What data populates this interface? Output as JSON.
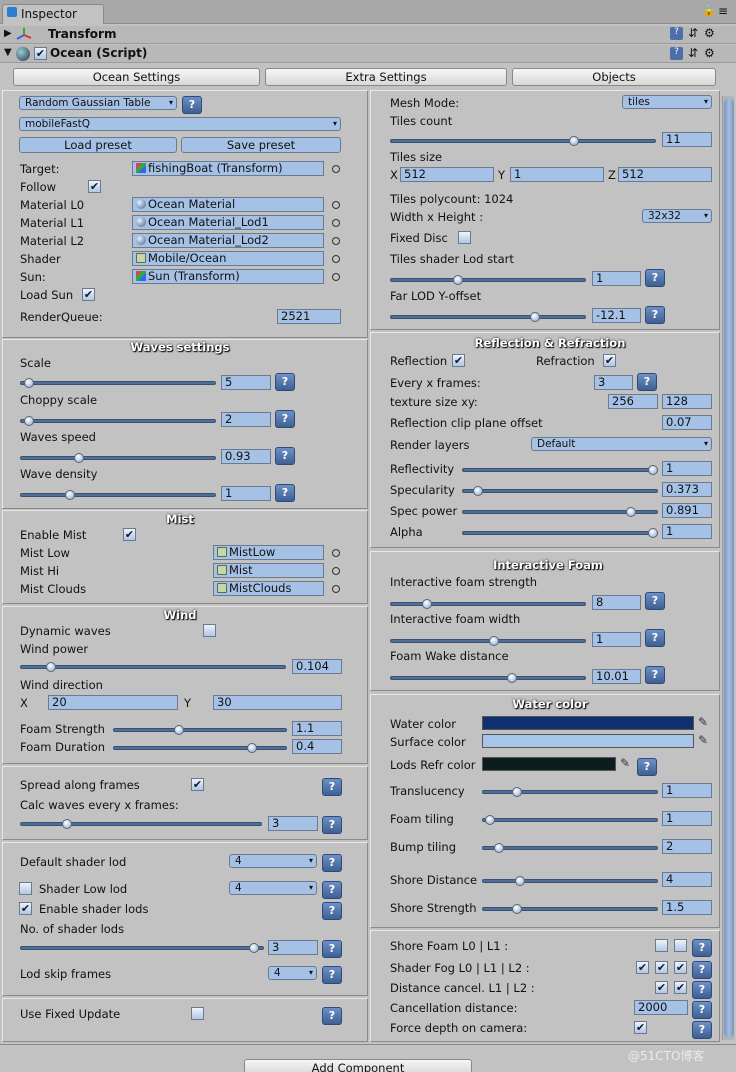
{
  "window": {
    "tab": "Inspector"
  },
  "transform": {
    "title": "Transform"
  },
  "ocean": {
    "title": "Ocean (Script)"
  },
  "tabs": {
    "ocean": "Ocean Settings",
    "extra": "Extra Settings",
    "objects": "Objects"
  },
  "left": {
    "table_dd": "Random Gaussian Table",
    "preset_dd": "mobileFastQ",
    "load_preset": "Load preset",
    "save_preset": "Save preset",
    "target_label": "Target:",
    "target_value": "fishingBoat (Transform)",
    "follow_label": "Follow",
    "mat0_label": "Material L0",
    "mat0_value": "Ocean Material",
    "mat1_label": "Material L1",
    "mat1_value": "Ocean Material_Lod1",
    "mat2_label": "Material L2",
    "mat2_value": "Ocean Material_Lod2",
    "shader_label": "Shader",
    "shader_value": "Mobile/Ocean",
    "sun_label": "Sun:",
    "sun_value": "Sun (Transform)",
    "loadsun_label": "Load Sun",
    "rq_label": "RenderQueue:",
    "rq_value": "2521",
    "waves_title": "Waves settings",
    "scale_label": "Scale",
    "scale_value": "5",
    "scale_frac": 0.02,
    "choppy_label": "Choppy scale",
    "choppy_value": "2",
    "choppy_frac": 0.02,
    "speed_label": "Waves speed",
    "speed_value": "0.93",
    "speed_frac": 0.29,
    "density_label": "Wave density",
    "density_value": "1",
    "density_frac": 0.24,
    "mist_title": "Mist",
    "enable_mist": "Enable Mist",
    "mistlow_label": "Mist Low",
    "mistlow_value": "MistLow",
    "misthi_label": "Mist Hi",
    "misthi_value": "Mist",
    "mistclouds_label": "Mist Clouds",
    "mistclouds_value": "MistClouds",
    "wind_title": "Wind",
    "dynamic_label": "Dynamic waves",
    "windpower_label": "Wind power",
    "windpower_value": "0.104",
    "windpower_frac": 0.1,
    "winddir_label": "Wind direction",
    "winddir_x_label": "X",
    "winddir_x": "20",
    "winddir_y_label": "Y",
    "winddir_y": "30",
    "foamstr_label": "Foam Strength",
    "foamstr_value": "1.1",
    "foamstr_frac": 0.37,
    "foamdur_label": "Foam Duration",
    "foamdur_value": "0.4",
    "foamdur_frac": 0.82,
    "spread_label": "Spread along frames",
    "calc_label": "Calc waves every x frames:",
    "calc_value": "3",
    "calc_frac": 0.18,
    "defshader_label": "Default shader lod",
    "defshader_value": "4",
    "shaderlow_label": "Shader Low lod",
    "shaderlow_value": "4",
    "enablelods_label": "Enable shader lods",
    "numlods_label": "No. of shader lods",
    "numlods_value": "3",
    "numlods_frac": 0.98,
    "lodskip_label": "Lod skip frames",
    "lodskip_value": "4",
    "fixedupd_label": "Use Fixed Update"
  },
  "right": {
    "meshmode_label": "Mesh Mode:",
    "meshmode_value": "tiles",
    "tilescount_label": "Tiles count",
    "tilescount_value": "11",
    "tilescount_frac": 0.7,
    "tilessize_label": "Tiles size",
    "ts_x_label": "X",
    "ts_x": "512",
    "ts_y_label": "Y",
    "ts_y": "1",
    "ts_z_label": "Z",
    "ts_z": "512",
    "polycount_label": "Tiles polycount: 1024",
    "wh_label": "Width x Height :",
    "wh_value": "32x32",
    "fixeddisc_label": "Fixed Disc",
    "tileslod_label": "Tiles shader Lod start",
    "tileslod_value": "1",
    "tileslod_frac": 0.34,
    "farlod_label": "Far LOD Y-offset",
    "farlod_value": "-12.1",
    "farlod_frac": 0.75,
    "refl_title": "Reflection & Refraction",
    "reflection_label": "Reflection",
    "refraction_label": "Refraction",
    "everyx_label": "Every x frames:",
    "everyx_value": "3",
    "texsize_label": "texture size  xy:",
    "tex_x": "256",
    "tex_y": "128",
    "clip_label": "Reflection clip plane offset",
    "clip_value": "0.07",
    "layers_label": "Render layers",
    "layers_value": "Default",
    "reflectivity_label": "Reflectivity",
    "reflectivity_value": "1",
    "reflectivity_frac": 1.0,
    "specularity_label": "Specularity",
    "specularity_value": "0.373",
    "specularity_frac": 0.06,
    "specpower_label": "Spec power",
    "specpower_value": "0.891",
    "specpower_frac": 0.88,
    "alpha_label": "Alpha",
    "alpha_value": "1",
    "alpha_frac": 1.0,
    "foam_title": "Interactive Foam",
    "ifstr_label": "Interactive foam strength",
    "ifstr_value": "8",
    "ifstr_frac": 0.17,
    "ifwidth_label": "Interactive foam width",
    "ifwidth_value": "1",
    "ifwidth_frac": 0.53,
    "wake_label": "Foam Wake distance",
    "wake_value": "10.01",
    "wake_frac": 0.63,
    "water_title": "Water color",
    "watercolor_label": "Water color",
    "watercolor": "#10306f",
    "surfacecolor_label": "Surface color",
    "surfacecolor": "#a7c4e9",
    "lodsrefr_label": "Lods Refr color",
    "lodsrefr": "#0c1d1f",
    "translucency_label": "Translucency",
    "translucency_value": "1",
    "translucency_frac": 0.18,
    "foamtiling_label": "Foam tiling",
    "foamtiling_value": "1",
    "foamtiling_frac": 0.02,
    "bumptiling_label": "Bump tiling",
    "bumptiling_value": "2",
    "bumptiling_frac": 0.07,
    "shoredist_label": "Shore Distance",
    "shoredist_value": "4",
    "shoredist_frac": 0.2,
    "shorestr_label": "Shore Strength",
    "shorestr_value": "1.5",
    "shorestr_frac": 0.18,
    "shorefoam_label": "Shore Foam L0 | L1       :",
    "shaderfog_label": "Shader Fog  L0 | L1 | L2 :",
    "distcancel_label": "Distance cancel.  L1 | L2 :",
    "cancdist_label": "Cancellation distance:",
    "cancdist_value": "2000",
    "forcedepth_label": "Force depth on camera:"
  },
  "footer": {
    "add_component": "Add Component",
    "watermark": "@51CTO博客"
  },
  "glyphs": {
    "check": "✔",
    "q": "?",
    "arrow": "▾",
    "pipette": "✎",
    "gear": "⚙",
    "help": "?",
    "sliders": "⇵"
  }
}
